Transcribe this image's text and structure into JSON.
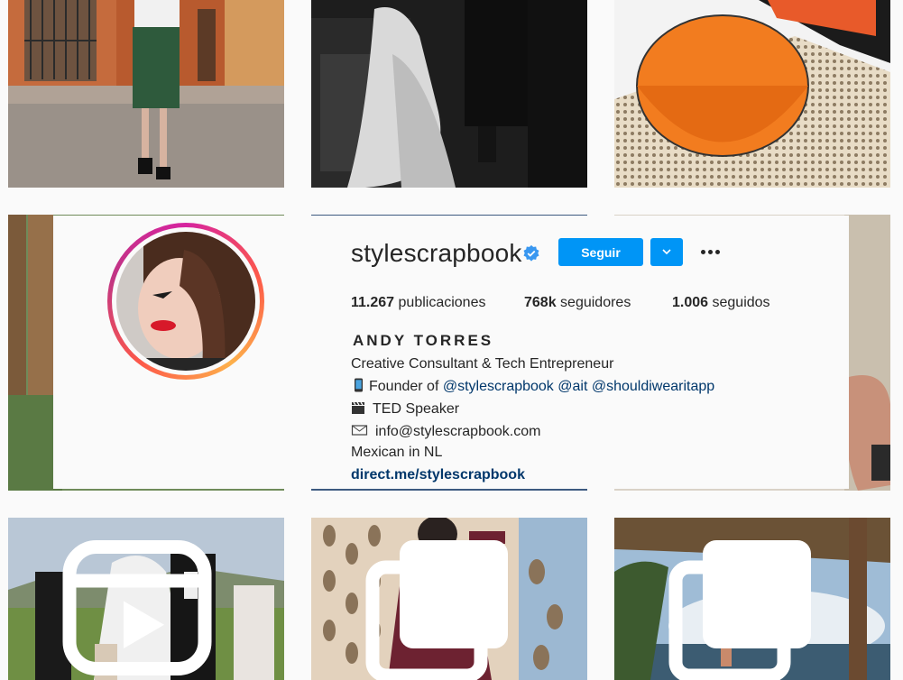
{
  "profile": {
    "username": "stylescrapbook",
    "follow_label": "Seguir",
    "stats": {
      "posts_count": "11.267",
      "posts_label": "publicaciones",
      "followers_count": "768k",
      "followers_label": "seguidores",
      "following_count": "1.006",
      "following_label": "seguidos"
    },
    "full_name": "ANDY TORRES",
    "bio": {
      "line1": "Creative Consultant & Tech Entrepreneur",
      "line2_prefix": "Founder of",
      "mention1": "@stylescrapbook",
      "mention2": "@ait",
      "mention3": "@shouldiwearitapp",
      "line3": "TED Speaker",
      "line4": "info@stylescrapbook.com",
      "line5": "Mexican in NL",
      "link": "direct.me/stylescrapbook"
    },
    "icons": {
      "verified": "verified-badge-icon",
      "dropdown": "chevron-down-icon",
      "more": "more-options-icon",
      "phone": "mobile-phone-icon",
      "clapper": "clapper-board-icon",
      "email": "envelope-icon"
    }
  },
  "grid": {
    "post_overlay_icons": [
      "reel-icon",
      "carousel-icon",
      "carousel-icon"
    ]
  },
  "colors": {
    "accent": "#0095f6",
    "link": "#00376b",
    "text": "#262626",
    "background": "#fafafa"
  }
}
